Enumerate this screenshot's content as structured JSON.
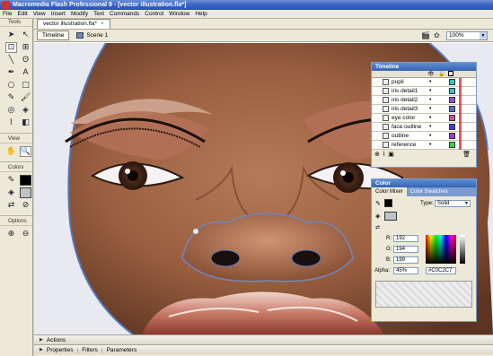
{
  "window": {
    "title": "Macromedia Flash Professional 8 - [vector illustration.fla*]"
  },
  "menu": [
    "File",
    "Edit",
    "View",
    "Insert",
    "Modify",
    "Text",
    "Commands",
    "Control",
    "Window",
    "Help"
  ],
  "tools": {
    "header": "Tools",
    "view_header": "View",
    "colors_header": "Colors",
    "options_header": "Options"
  },
  "document": {
    "tab_label": "vector illustration.fla*",
    "timeline_button": "Timeline",
    "scene_label": "Scene 1",
    "zoom_value": "100%"
  },
  "timeline_panel": {
    "title": "Timeline",
    "layers": [
      {
        "name": "pupil",
        "color": "#3fbfbf"
      },
      {
        "name": "iris detail1",
        "color": "#3fbfbf"
      },
      {
        "name": "iris detail2",
        "color": "#9a4fd0"
      },
      {
        "name": "iris detail3",
        "color": "#4f6fd0"
      },
      {
        "name": "eye color",
        "color": "#d04fa0"
      },
      {
        "name": "face outline",
        "color": "#3f3fd0"
      },
      {
        "name": "outline",
        "color": "#9a3fd0"
      },
      {
        "name": "reference",
        "color": "#3fd04f"
      }
    ]
  },
  "color_panel": {
    "title": "Color",
    "tabs": [
      "Color Mixer",
      "Color Swatches"
    ],
    "type_label": "Type:",
    "type_value": "Solid",
    "r_label": "R:",
    "r": "192",
    "g_label": "G:",
    "g": "194",
    "b_label": "B:",
    "b": "199",
    "alpha_label": "Alpha:",
    "alpha": "45%",
    "hex": "#C0C2C7",
    "swatch_color": "#c0c2c7"
  },
  "bottom_panels": {
    "actions": "Actions",
    "properties": "Properties",
    "filters": "Filters",
    "parameters": "Parameters"
  }
}
